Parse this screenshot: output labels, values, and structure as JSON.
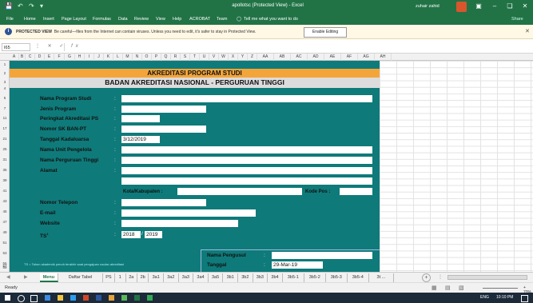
{
  "window": {
    "title": "apollotsc (Protected View) - Excel",
    "user": "zuhair zahid"
  },
  "menu": [
    "File",
    "Home",
    "Insert",
    "Page Layout",
    "Formulas",
    "Data",
    "Review",
    "View",
    "Help",
    "ACROBAT",
    "Team"
  ],
  "tell_me": "Tell me what you want to do",
  "share": "Share",
  "protected_view": {
    "label": "PROTECTED VIEW",
    "message": "Be careful—files from the Internet can contain viruses. Unless you need to edit, it's safer to stay in Protected View.",
    "enable_button": "Enable Editing"
  },
  "formula_bar": {
    "cell": "I65",
    "fx": "fx",
    "value": ""
  },
  "columns": [
    "A",
    "B",
    "C",
    "D",
    "E",
    "F",
    "G",
    "H",
    "I",
    "J",
    "K",
    "L",
    "M",
    "N",
    "O",
    "P",
    "Q",
    "R",
    "S",
    "T",
    "U",
    "V",
    "W",
    "X",
    "Y",
    "Z",
    "AA",
    "AB",
    "AC",
    "AD",
    "AE",
    "AF",
    "AG",
    "AH"
  ],
  "rows": [
    "1",
    "2",
    "3",
    "4",
    "5",
    "7",
    "11",
    "17",
    "21",
    "25",
    "31",
    "35",
    "39",
    "41",
    "43",
    "45",
    "47",
    "49",
    "51",
    "53",
    "55",
    "57",
    "59"
  ],
  "form": {
    "title1": "AKREDITASI PROGRAM STUDI",
    "title2": "BADAN AKREDITASI NASIONAL - PERGURUAN TINGGI",
    "fields": [
      {
        "label": "Nama Program Studi",
        "value": ""
      },
      {
        "label": "Jenis Program",
        "value": ""
      },
      {
        "label": "Peringkat Akreditasi PS",
        "value": ""
      },
      {
        "label": "Nomor SK BAN-PT",
        "value": ""
      },
      {
        "label": "Tanggal Kadaluarsa",
        "value": "3/12/2019"
      },
      {
        "label": "Nama Unit Pengelola",
        "value": ""
      },
      {
        "label": "Nama Perguruan Tinggi",
        "value": ""
      },
      {
        "label": "Alamat",
        "value": ""
      },
      {
        "label": "Nomor Telepon",
        "value": ""
      },
      {
        "label": "E-mail",
        "value": ""
      },
      {
        "label": "Website",
        "value": ""
      },
      {
        "label": "TS",
        "value": ""
      }
    ],
    "colon": ":",
    "kota_label": "Kota/Kabupaten :",
    "kode_pos_label": "Kode Pos :",
    "ts_year_1": "2018",
    "ts_year_2": "2019",
    "ts_separator": "/",
    "ts_marker": "1",
    "ts_note": "TS = Tahun akademik penuh terakhir saat pengajuan usulan akreditasi",
    "pengusul_label": "Nama Pengusul",
    "tanggal_label": "Tanggal",
    "tanggal_value": "29-Mar-19"
  },
  "sheet_tabs": [
    "Menu",
    "Daftar Tabel",
    "PS",
    "1",
    "2a",
    "2b",
    "3a1",
    "3a2",
    "3a3",
    "3a4",
    "3a5",
    "3b1",
    "3b2",
    "3b3",
    "3b4",
    "3b5-1",
    "3b5-2",
    "3b5-3",
    "3b5-4",
    "3t ..."
  ],
  "active_tab": "Menu",
  "status": {
    "text": "Ready",
    "zoom": "+ 70%"
  },
  "taskbar": {
    "time": "10:10 PM",
    "lang": "ENG"
  }
}
